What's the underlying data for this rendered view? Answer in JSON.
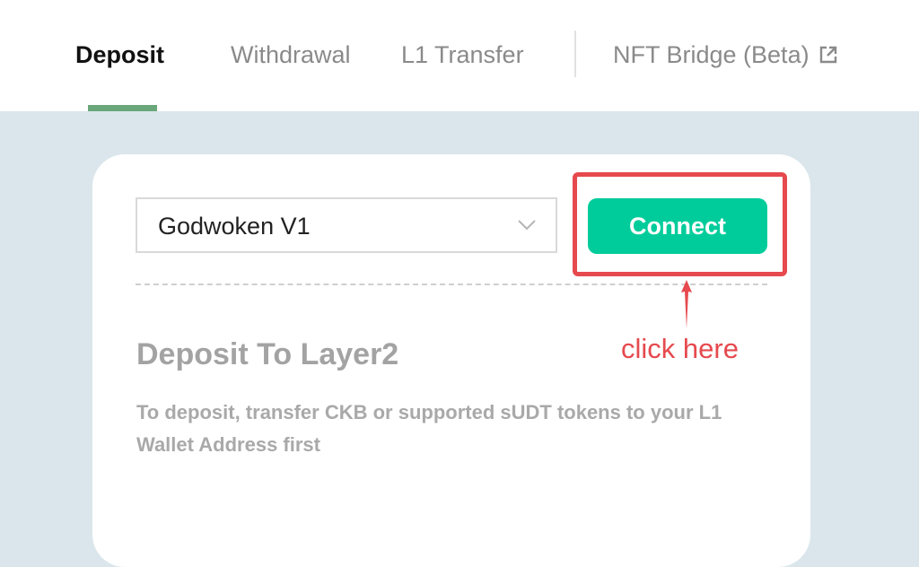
{
  "tabs": {
    "deposit": "Deposit",
    "withdrawal": "Withdrawal",
    "l1_transfer": "L1 Transfer",
    "nft_bridge": "NFT Bridge (Beta)",
    "active": "Deposit"
  },
  "network_select": {
    "value": "Godwoken V1"
  },
  "connect_button": {
    "label": "Connect",
    "color": "#00cc9b"
  },
  "annotation": {
    "text": "click here",
    "color": "#e6494e"
  },
  "deposit_section": {
    "title": "Deposit To Layer2",
    "description": "To deposit, transfer CKB or supported sUDT tokens to your L1 Wallet Address first"
  },
  "colors": {
    "page_background": "#dae6eb",
    "active_tab_underline": "#6aa77a"
  },
  "icons": {
    "nft_tab": "external-link-icon",
    "select": "chevron-down-icon",
    "annotation": "arrow-up-icon"
  }
}
